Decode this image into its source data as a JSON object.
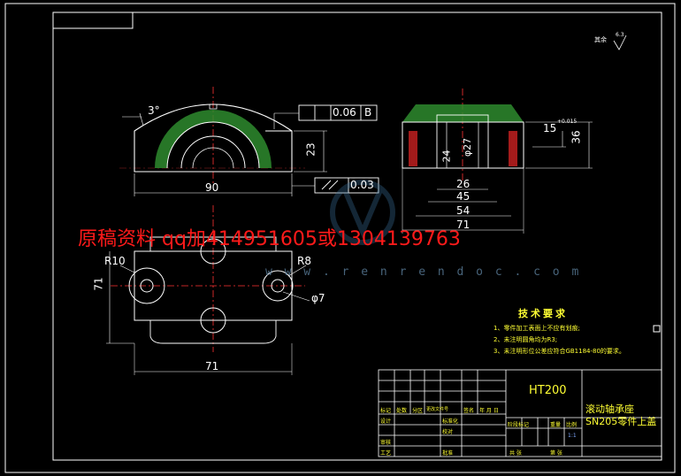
{
  "watermark": {
    "text": "原稿资料  qq加414951605或1304139763",
    "url": "w w w . r e n r e n d o c . c o m"
  },
  "roughness": {
    "label": "其余",
    "value": "6.3"
  },
  "dims": {
    "angle": "3°",
    "tolerance_value": "0.06",
    "tolerance_datum": "B",
    "parallel_value": "0.03",
    "height_23": "23",
    "width_90": "90",
    "d26": "26",
    "d45": "45",
    "d54": "54",
    "d71_top": "71",
    "d15": "15",
    "d15_tol": "+0.015",
    "d36": "36",
    "d24": "24",
    "d27": "φ27",
    "r10": "R10",
    "r8": "R8",
    "phi7": "φ7",
    "d71_left": "71",
    "d71_bottom": "71"
  },
  "requirements": {
    "title": "技术要求",
    "items": [
      "1、零件加工表面上不应有划痕;",
      "2、未注明圆角均为R3;",
      "3、未注明形位公差应符合GB1184-80的要求。"
    ]
  },
  "title_block": {
    "material": "HT200",
    "name_line1": "滚动轴承座",
    "name_line2": "SN205零件上盖",
    "labels": [
      "标记",
      "处数",
      "分区",
      "更改文件号",
      "签名",
      "年 月 日",
      "设计",
      "标准化",
      "审核",
      "批准",
      "工艺",
      "校对",
      "阶段标记",
      "重量",
      "比例",
      "共  张",
      "第  张"
    ],
    "scale": "1:1"
  }
}
